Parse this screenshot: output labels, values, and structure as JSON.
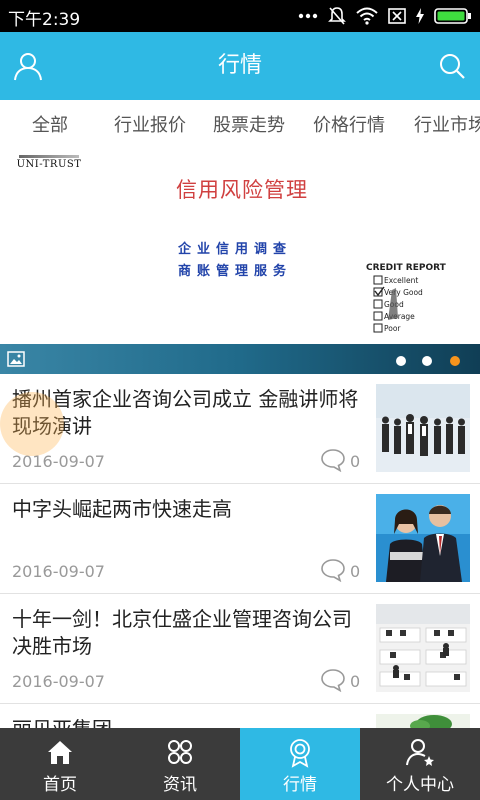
{
  "status_bar": {
    "time": "下午2:39"
  },
  "header": {
    "title": "行情"
  },
  "category_tabs": [
    "全部",
    "行业报价",
    "股票走势",
    "价格行情",
    "行业市场"
  ],
  "banner": {
    "logo_text": "UNI-TRUST",
    "heading": "信用风险管理",
    "line1": "企业信用调查",
    "line2": "商账管理服务",
    "report_title": "CREDIT REPORT",
    "report_options": [
      "Excellent",
      "Very Good",
      "Good",
      "Average",
      "Poor"
    ],
    "active_slide": 3,
    "slide_count": 3
  },
  "news": [
    {
      "title": "播州首家企业咨询公司成立 金融讲师将现场演讲",
      "date": "2016-09-07",
      "comments": "0"
    },
    {
      "title": "中字头崛起两市快速走高",
      "date": "2016-09-07",
      "comments": "0"
    },
    {
      "title": "十年一剑！北京仕盛企业管理咨询公司决胜市场",
      "date": "2016-09-07",
      "comments": "0"
    },
    {
      "title": "丽贝亚集团"
    }
  ],
  "bottom_nav": [
    {
      "label": "首页",
      "icon": "home-icon"
    },
    {
      "label": "资讯",
      "icon": "grid-icon"
    },
    {
      "label": "行情",
      "icon": "badge-icon",
      "active": true
    },
    {
      "label": "个人中心",
      "icon": "user-star-icon"
    }
  ],
  "colors": {
    "accent": "#2fb9e4",
    "nav_bg": "#3b3b3b",
    "dot_active": "#f7941d",
    "status_bg": "#000000"
  }
}
